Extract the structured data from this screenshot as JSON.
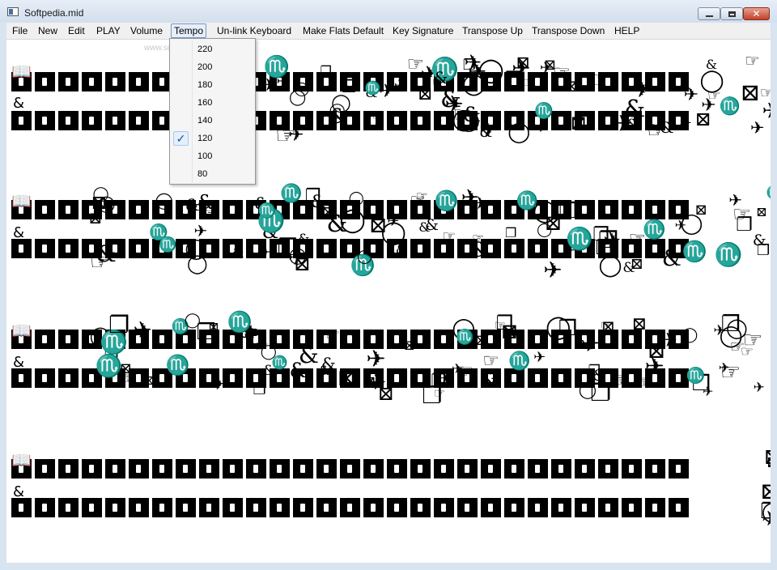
{
  "window": {
    "title": "Softpedia.mid",
    "minimize_icon": "minimize-icon",
    "maximize_icon": "maximize-icon",
    "close_icon": "close-icon",
    "close_glyph": "✕"
  },
  "menu": {
    "items": [
      {
        "label": "File",
        "name": "menu-file"
      },
      {
        "label": "New",
        "name": "menu-new"
      },
      {
        "label": "Edit",
        "name": "menu-edit"
      },
      {
        "label": "PLAY",
        "name": "menu-play"
      },
      {
        "label": "Volume",
        "name": "menu-volume"
      },
      {
        "label": "Tempo",
        "name": "menu-tempo"
      },
      {
        "label": "Un-link Keyboard",
        "name": "menu-unlink-keyboard"
      },
      {
        "label": "Make Flats Default",
        "name": "menu-make-flats-default"
      },
      {
        "label": "Key Signature",
        "name": "menu-key-signature"
      },
      {
        "label": "Transpose Up",
        "name": "menu-transpose-up"
      },
      {
        "label": "Transpose Down",
        "name": "menu-transpose-down"
      },
      {
        "label": "HELP",
        "name": "menu-help"
      }
    ],
    "open_menu": "Tempo"
  },
  "tempo_menu": {
    "options": [
      "220",
      "200",
      "180",
      "160",
      "140",
      "120",
      "100",
      "80"
    ],
    "selected": "120",
    "check_glyph": "✓"
  },
  "watermark": "www.softpedia.com",
  "score": {
    "cell_icon": "note-block-icon",
    "symbol_glyphs": [
      "&",
      "☞",
      "♏",
      "✈",
      "◯",
      "❐",
      "⊠"
    ]
  }
}
